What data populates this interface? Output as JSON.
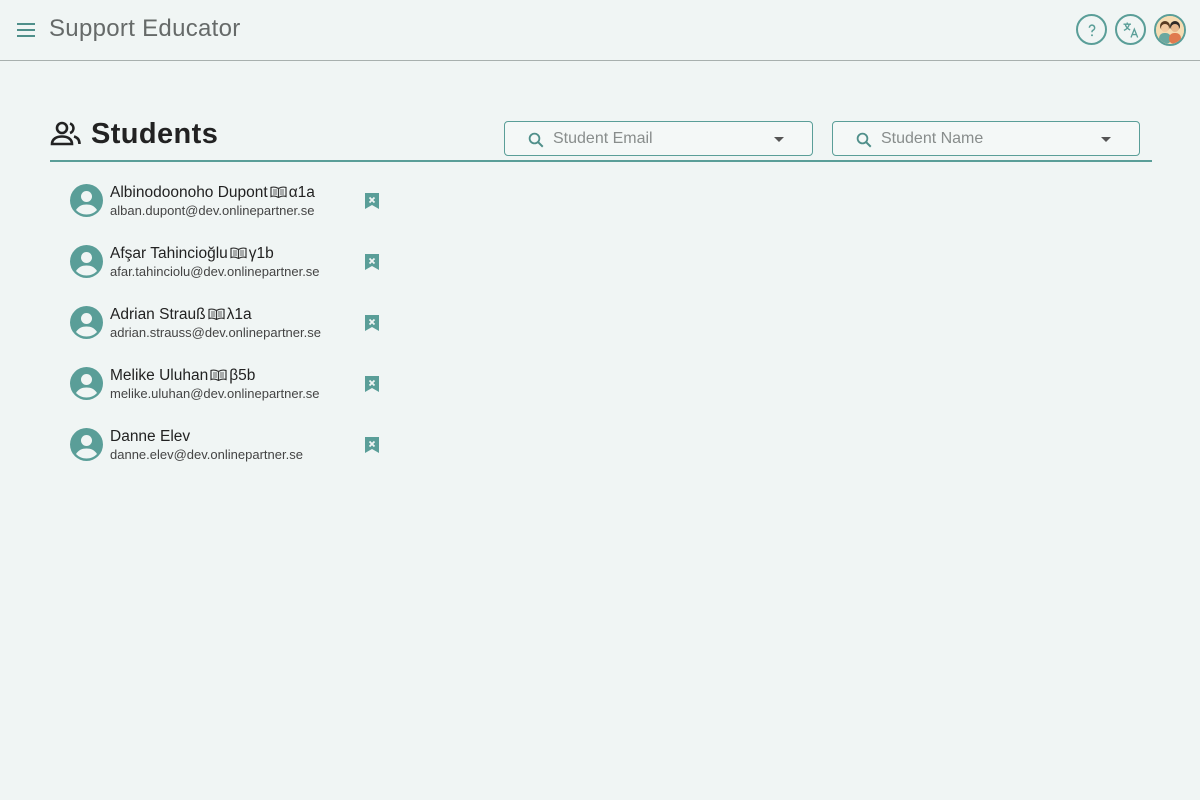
{
  "app": {
    "title": "Support Educator"
  },
  "page": {
    "title": "Students"
  },
  "filters": {
    "email": {
      "placeholder": "Student Email"
    },
    "name": {
      "placeholder": "Student Name"
    }
  },
  "students": [
    {
      "name": "Albinodoonoho Dupont",
      "group": "α1a",
      "email": "alban.dupont@dev.onlinepartner.se"
    },
    {
      "name": "Afşar Tahincioğlu",
      "group": "γ1b",
      "email": "afar.tahinciolu@dev.onlinepartner.se"
    },
    {
      "name": "Adrian Strauß",
      "group": "λ1a",
      "email": "adrian.strauss@dev.onlinepartner.se"
    },
    {
      "name": "Melike Uluhan",
      "group": "β5b",
      "email": "melike.uluhan@dev.onlinepartner.se"
    },
    {
      "name": "Danne Elev",
      "group": "",
      "email": "danne.elev@dev.onlinepartner.se"
    }
  ],
  "colors": {
    "accent": "#5a9e98",
    "background": "#f0f5f4"
  },
  "icons": {
    "menu": "hamburger-menu-icon",
    "help": "help-icon",
    "translate": "translate-icon",
    "avatar": "user-avatar",
    "page": "group-icon",
    "search": "search-icon",
    "student": "account-circle-icon",
    "group": "book-icon",
    "remove": "bookmark-remove-icon"
  }
}
